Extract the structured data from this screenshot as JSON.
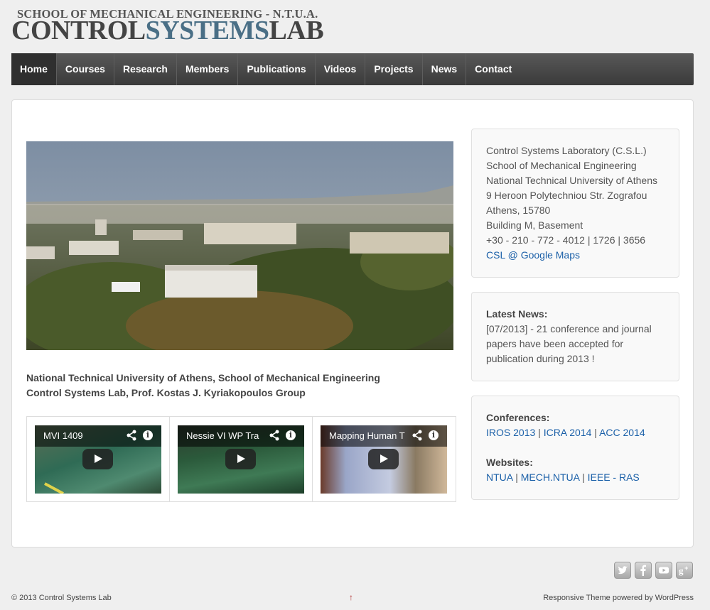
{
  "header": {
    "logo_top": "SCHOOL OF MECHANICAL ENGINEERING - N.T.U.A.",
    "logo_part1": "CONTROL",
    "logo_part2": "SYSTEMS",
    "logo_part3": "LAB",
    "accent_color": "#4a6f86"
  },
  "nav": {
    "items": [
      {
        "label": "Home",
        "active": true
      },
      {
        "label": "Courses"
      },
      {
        "label": "Research"
      },
      {
        "label": "Members"
      },
      {
        "label": "Publications"
      },
      {
        "label": "Videos"
      },
      {
        "label": "Projects"
      },
      {
        "label": "News"
      },
      {
        "label": "Contact"
      }
    ]
  },
  "main": {
    "caption_line1": "National Technical University of Athens, School of Mechanical Engineering",
    "caption_line2": "Control Systems Lab, Prof. Kostas J. Kyriakopoulos Group",
    "videos": [
      {
        "title": "MVI 1409"
      },
      {
        "title": "Nessie VI WP Tra"
      },
      {
        "title": "Mapping Human T"
      }
    ]
  },
  "sidebar": {
    "contact": {
      "lines": [
        "Control Systems Laboratory (C.S.L.)",
        "School of Mechanical Engineering",
        "National Technical University of Athens",
        "9 Heroon Polytechniou Str. Zografou",
        "Athens, 15780",
        "Building M, Basement",
        "+30 - 210 - 772 - 4012 | 1726 | 3656"
      ],
      "map_link": "CSL @ Google Maps"
    },
    "news": {
      "title": "Latest News:",
      "text": "[07/2013] - 21 conference and journal papers have been accepted for publication during 2013 !"
    },
    "conferences": {
      "title": "Conferences:",
      "links": [
        "IROS 2013",
        "ICRA 2014",
        "ACC 2014"
      ]
    },
    "websites": {
      "title": "Websites:",
      "links": [
        "NTUA",
        "MECH.NTUA",
        "IEEE - RAS"
      ]
    }
  },
  "social": [
    "twitter-icon",
    "facebook-icon",
    "youtube-icon",
    "google-plus-icon"
  ],
  "footer": {
    "copyright": "© 2013 Control Systems Lab",
    "up_arrow": "↑",
    "theme_link": "Responsive Theme",
    "powered_by": "powered by",
    "wordpress_link": "WordPress"
  }
}
